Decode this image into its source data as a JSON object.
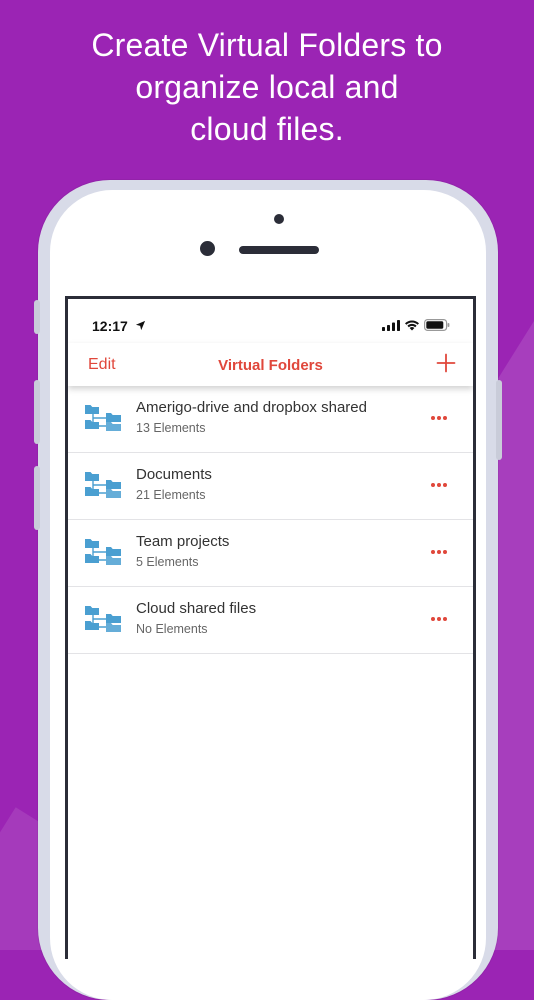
{
  "headline": {
    "line1": "Create Virtual Folders to",
    "line2": "organize local and",
    "line3": "cloud files."
  },
  "status_bar": {
    "time": "12:17",
    "icons": [
      "location-arrow-icon",
      "cellular-signal-icon",
      "wifi-icon",
      "battery-icon"
    ]
  },
  "nav": {
    "edit_label": "Edit",
    "title": "Virtual Folders",
    "add_icon": "plus-icon"
  },
  "folders": [
    {
      "title": "Amerigo-drive and dropbox shared",
      "subtitle": "13 Elements",
      "icon": "virtual-folder-icon",
      "menu_icon": "more-options-icon"
    },
    {
      "title": "Documents",
      "subtitle": "21 Elements",
      "icon": "virtual-folder-icon",
      "menu_icon": "more-options-icon"
    },
    {
      "title": "Team projects",
      "subtitle": "5 Elements",
      "icon": "virtual-folder-icon",
      "menu_icon": "more-options-icon"
    },
    {
      "title": "Cloud shared files",
      "subtitle": "No Elements",
      "icon": "virtual-folder-icon",
      "menu_icon": "more-options-icon"
    }
  ],
  "colors": {
    "background": "#9b24b4",
    "accent": "#e0473b",
    "folder_blue": "#4a9fd1"
  }
}
